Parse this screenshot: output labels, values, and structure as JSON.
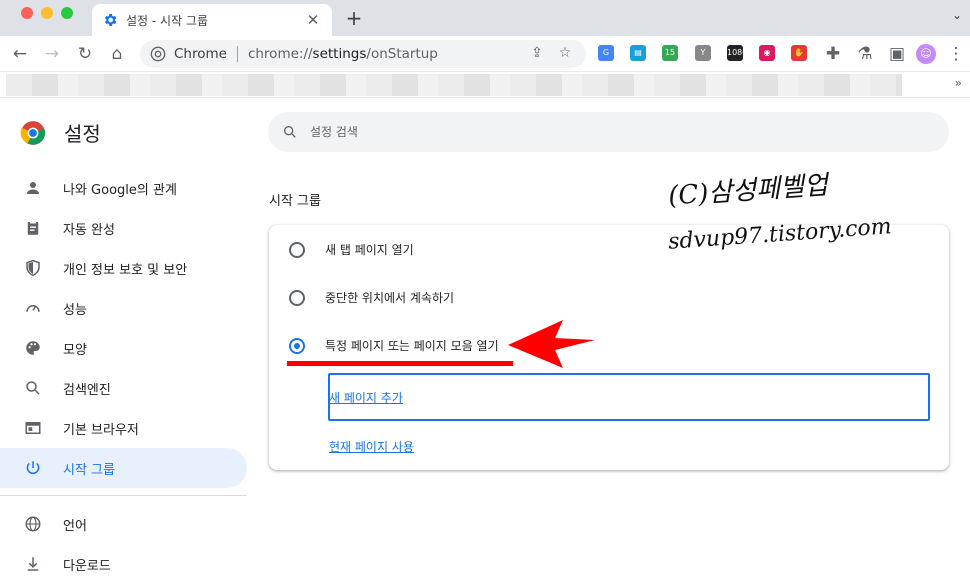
{
  "window": {
    "tab_title": "설정 - 시작 그룹",
    "new_tab": "+",
    "close": "✕",
    "tab_menu": "⌄"
  },
  "toolbar": {
    "site_label": "Chrome",
    "url_prefix": "chrome://",
    "url_host": "settings",
    "url_path": "/onStartup",
    "extensions": [
      {
        "name": "google-translate-icon",
        "color": "#4285f4",
        "text": "G"
      },
      {
        "name": "book-ext-icon",
        "color": "#1a9fd8",
        "text": "▤"
      },
      {
        "name": "green-ext-icon",
        "color": "#34a853",
        "text": "15"
      },
      {
        "name": "tool-ext-icon",
        "color": "#888888",
        "text": "Y"
      },
      {
        "name": "1080-ext-icon",
        "color": "#222222",
        "text": "1080"
      },
      {
        "name": "color-ring-ext-icon",
        "color": "#d81b60",
        "text": "◉"
      },
      {
        "name": "red-hand-ext-icon",
        "color": "#e53935",
        "text": "✋"
      }
    ],
    "more_bookmarks": "»"
  },
  "sidebar": {
    "brand": "설정",
    "items": [
      {
        "label": "나와 Google의 관계",
        "icon": "person-icon"
      },
      {
        "label": "자동 완성",
        "icon": "clipboard-icon"
      },
      {
        "label": "개인 정보 보호 및 보안",
        "icon": "shield-icon"
      },
      {
        "label": "성능",
        "icon": "speedometer-icon"
      },
      {
        "label": "모양",
        "icon": "palette-icon"
      },
      {
        "label": "검색엔진",
        "icon": "search-icon"
      },
      {
        "label": "기본 브라우저",
        "icon": "browser-window-icon"
      },
      {
        "label": "시작 그룹",
        "icon": "power-icon",
        "active": true
      },
      {
        "label": "언어",
        "icon": "globe-icon"
      },
      {
        "label": "다운로드",
        "icon": "download-icon"
      }
    ]
  },
  "main": {
    "search_placeholder": "설정 검색",
    "section_title": "시작 그룹",
    "options": [
      {
        "label": "새 탭 페이지 열기",
        "checked": false
      },
      {
        "label": "중단한 위치에서 계속하기",
        "checked": false
      },
      {
        "label": "특정 페이지 또는 페이지 모음 열기",
        "checked": true
      }
    ],
    "add_page_link": "새 페이지 추가",
    "use_current_link": "현재 페이지 사용"
  },
  "overlay": {
    "watermark_line1": "(C)삼성페벨업",
    "watermark_line2": "sdvup97.tistory.com",
    "arrow_color": "#ff0000"
  }
}
